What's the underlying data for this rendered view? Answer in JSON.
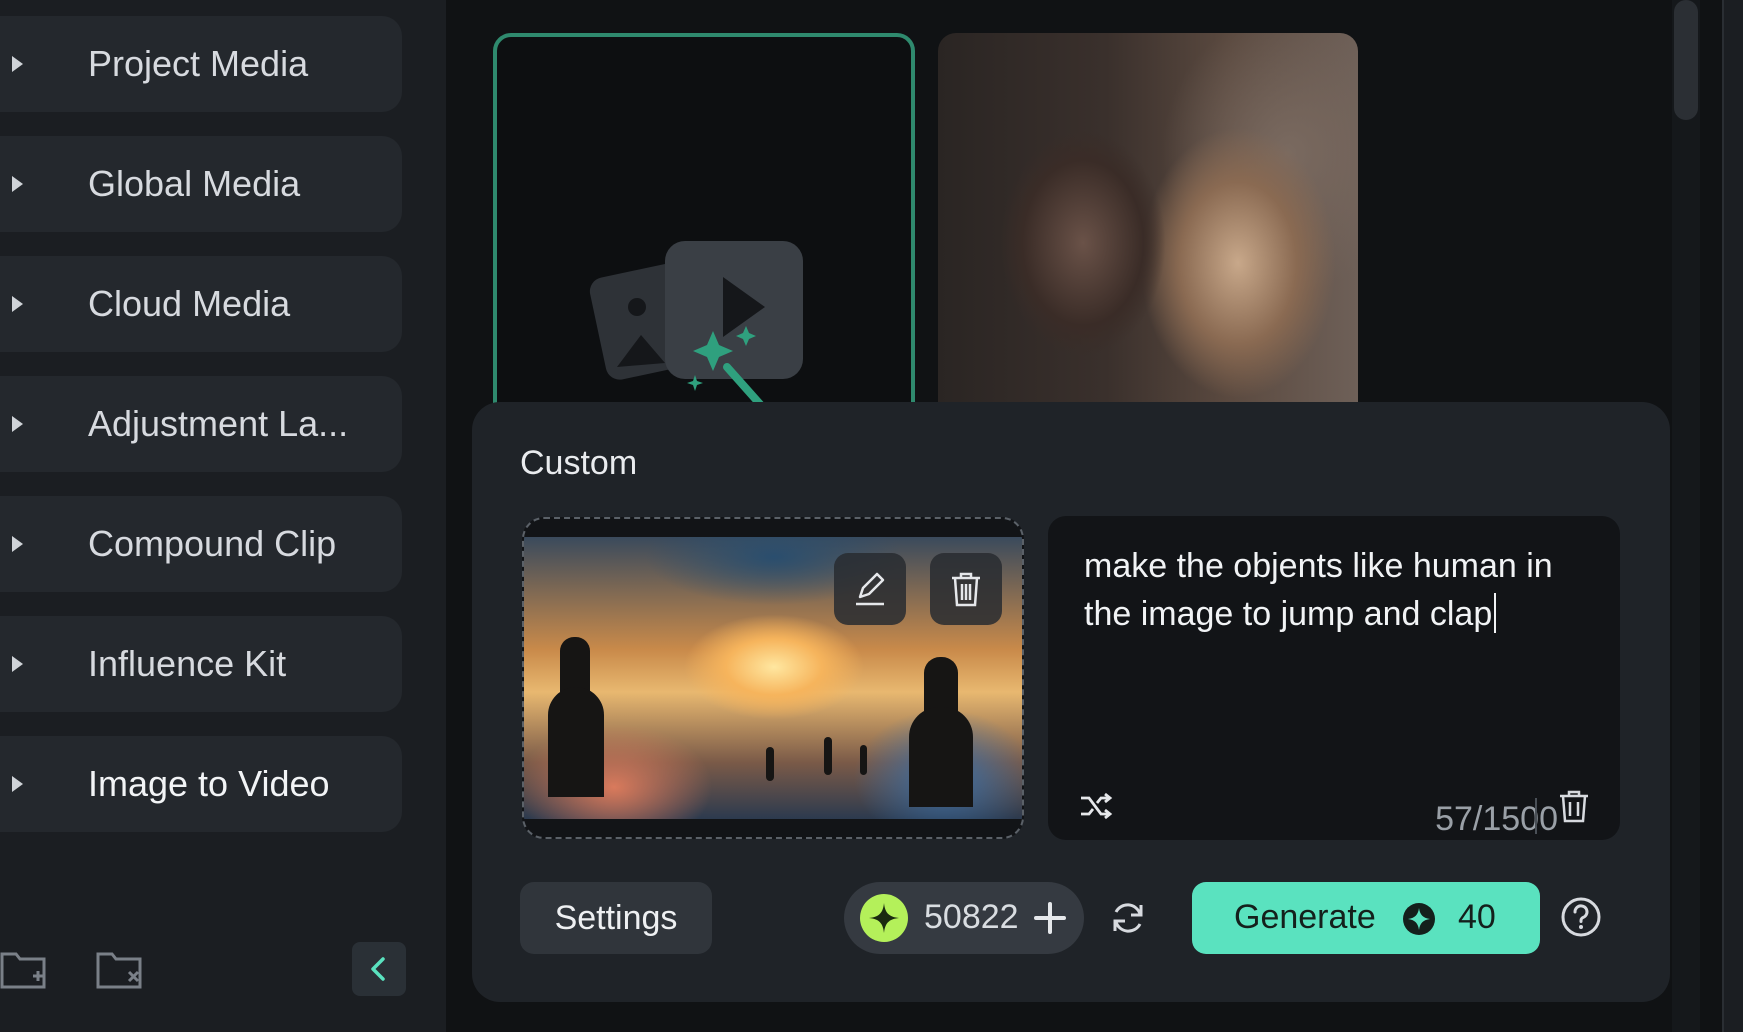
{
  "sidebar": {
    "items": [
      {
        "label": "Project Media",
        "icon": "caret-right-icon"
      },
      {
        "label": "Global Media",
        "icon": "caret-right-icon"
      },
      {
        "label": "Cloud Media",
        "icon": "caret-right-icon"
      },
      {
        "label": "Adjustment La...",
        "icon": "caret-right-icon"
      },
      {
        "label": "Compound Clip",
        "icon": "caret-right-icon"
      },
      {
        "label": "Influence Kit",
        "icon": "caret-right-icon"
      },
      {
        "label": "Image to Video",
        "icon": "caret-right-icon"
      }
    ],
    "bottom_icons": [
      "new-folder-icon",
      "delete-folder-icon",
      "chevron-left-icon"
    ]
  },
  "panel": {
    "title": "Custom",
    "prompt": "make the objents like human in the image to jump and clap",
    "char_count": "57/1500",
    "settings_label": "Settings",
    "credits": "50822",
    "generate_label": "Generate",
    "generate_cost": "40"
  },
  "colors": {
    "accent": "#5ae2bf",
    "selection_border": "#2f8a6e",
    "credit_coin": "#b4f05a",
    "panel_bg": "#1f2328"
  }
}
